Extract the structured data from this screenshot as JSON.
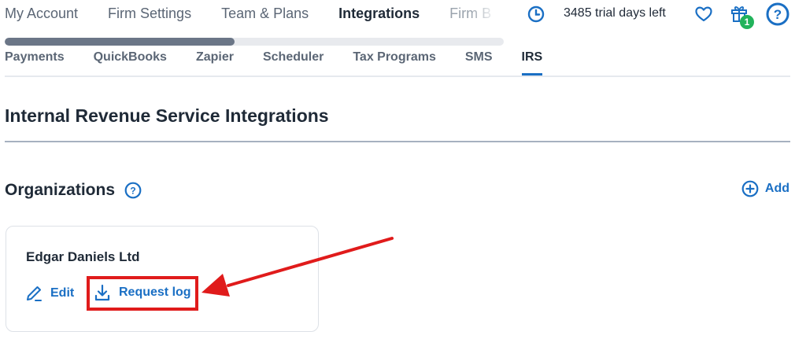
{
  "top_nav": {
    "tabs": [
      {
        "label": "My Account"
      },
      {
        "label": "Firm Settings"
      },
      {
        "label": "Team & Plans"
      },
      {
        "label": "Integrations",
        "active": true
      },
      {
        "label": "Firm B"
      }
    ],
    "scroll_progress": 0.46
  },
  "header_right": {
    "trial_text": "3485 trial days left",
    "gift_badge_count": "1",
    "icons": [
      "clock-icon",
      "heart-icon",
      "gift-icon",
      "help-icon"
    ]
  },
  "sub_nav": {
    "tabs": [
      {
        "label": "Payments"
      },
      {
        "label": "QuickBooks"
      },
      {
        "label": "Zapier"
      },
      {
        "label": "Scheduler"
      },
      {
        "label": "Tax Programs"
      },
      {
        "label": "SMS"
      },
      {
        "label": "IRS",
        "active": true
      }
    ]
  },
  "main": {
    "section_title": "Internal Revenue Service Integrations",
    "organizations_title": "Organizations",
    "add_label": "Add",
    "org_card": {
      "name": "Edgar Daniels Ltd",
      "edit_label": "Edit",
      "request_log_label": "Request log"
    }
  },
  "colors": {
    "accent": "#1a6fc4",
    "annotation": "#e01b1b",
    "badge": "#22b35b"
  }
}
